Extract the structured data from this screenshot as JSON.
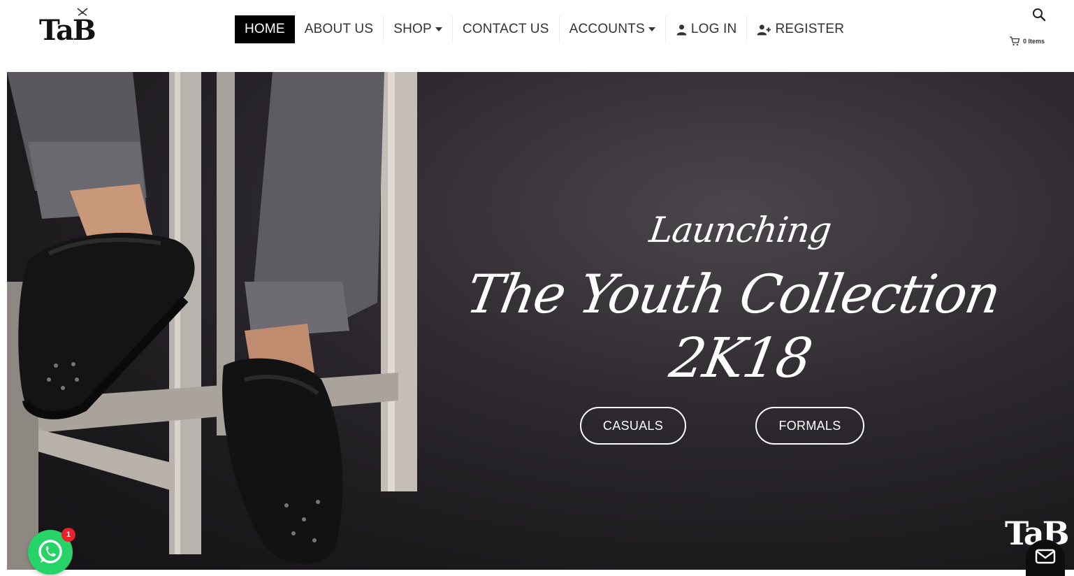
{
  "brand": {
    "logo_text": "TaB"
  },
  "nav": {
    "items": [
      {
        "label": "HOME",
        "active": true
      },
      {
        "label": "ABOUT US"
      },
      {
        "label": "SHOP",
        "dropdown": true
      },
      {
        "label": "CONTACT US"
      },
      {
        "label": "ACCOUNTS",
        "dropdown": true
      },
      {
        "label": "LOG IN",
        "icon": "user-icon"
      },
      {
        "label": "REGISTER",
        "icon": "user-plus-icon"
      }
    ]
  },
  "header": {
    "search_icon": "search-icon",
    "cart": {
      "icon": "cart-icon",
      "label": "0 Items"
    }
  },
  "hero": {
    "subtitle": "Launching",
    "title": "The Youth Collection",
    "year": "2K18",
    "buttons": {
      "casuals": "CASUALS",
      "formals": "FORMALS"
    }
  },
  "floating": {
    "whatsapp_badge": "1",
    "corner_logo": "TaB",
    "mail_icon": "mail-icon"
  },
  "colors": {
    "accent": "#000000",
    "hero_bg": "#2e2a30",
    "whatsapp": "#25d366",
    "badge": "#e8222b"
  }
}
